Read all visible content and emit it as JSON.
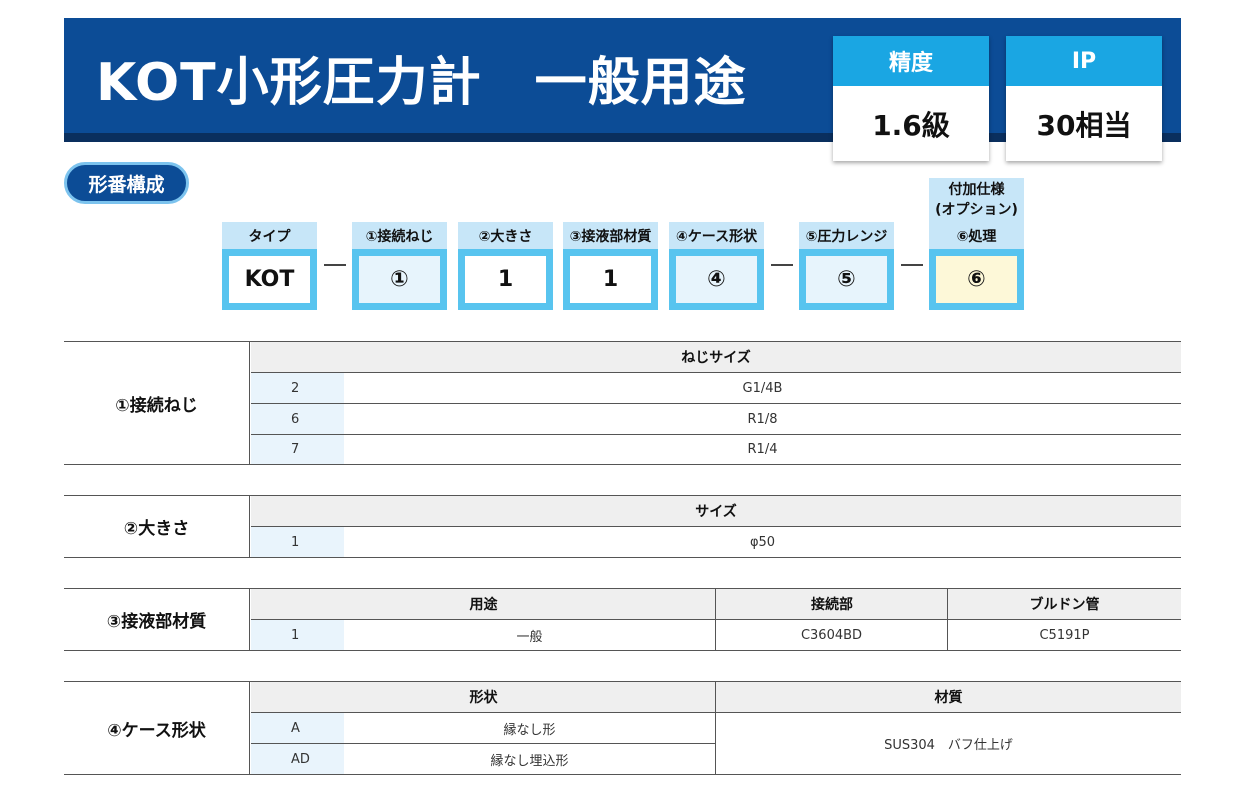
{
  "header": {
    "title": "KOT小形圧力計　一般用途",
    "specs": [
      {
        "label": "精度",
        "value": "1.6級"
      },
      {
        "label": "IP",
        "value": "30相当"
      }
    ]
  },
  "section_pill": "形番構成",
  "model_code": {
    "option_header": "付加仕様\n(オプション)",
    "columns": [
      {
        "label": "タイプ",
        "value": "KOT"
      },
      {
        "label": "①接続ねじ",
        "value": "①"
      },
      {
        "label": "②大きさ",
        "value": "1"
      },
      {
        "label": "③接液部材質",
        "value": "1"
      },
      {
        "label": "④ケース形状",
        "value": "④"
      },
      {
        "label": "⑤圧力レンジ",
        "value": "⑤"
      },
      {
        "label": "⑥処理",
        "value": "⑥"
      }
    ]
  },
  "tables": {
    "thread": {
      "label": "①接続ねじ",
      "header": "ねじサイズ",
      "rows": [
        {
          "code": "2",
          "value": "G1/4B"
        },
        {
          "code": "6",
          "value": "R1/8"
        },
        {
          "code": "7",
          "value": "R1/4"
        }
      ]
    },
    "size": {
      "label": "②大きさ",
      "header": "サイズ",
      "rows": [
        {
          "code": "1",
          "value": "φ50"
        }
      ]
    },
    "material": {
      "label": "③接液部材質",
      "headers": [
        "用途",
        "接続部",
        "ブルドン管"
      ],
      "rows": [
        {
          "code": "1",
          "use": "一般",
          "connection": "C3604BD",
          "bourdon": "C5191P"
        }
      ]
    },
    "case": {
      "label": "④ケース形状",
      "headers": [
        "形状",
        "材質"
      ],
      "rows": [
        {
          "code": "A",
          "shape": "縁なし形"
        },
        {
          "code": "AD",
          "shape": "縁なし埋込形"
        }
      ],
      "material": "SUS304　バフ仕上げ"
    }
  },
  "colors": {
    "banner": "#0c4c96",
    "accent": "#1aa6e3",
    "code_frame": "#58c4ef"
  }
}
